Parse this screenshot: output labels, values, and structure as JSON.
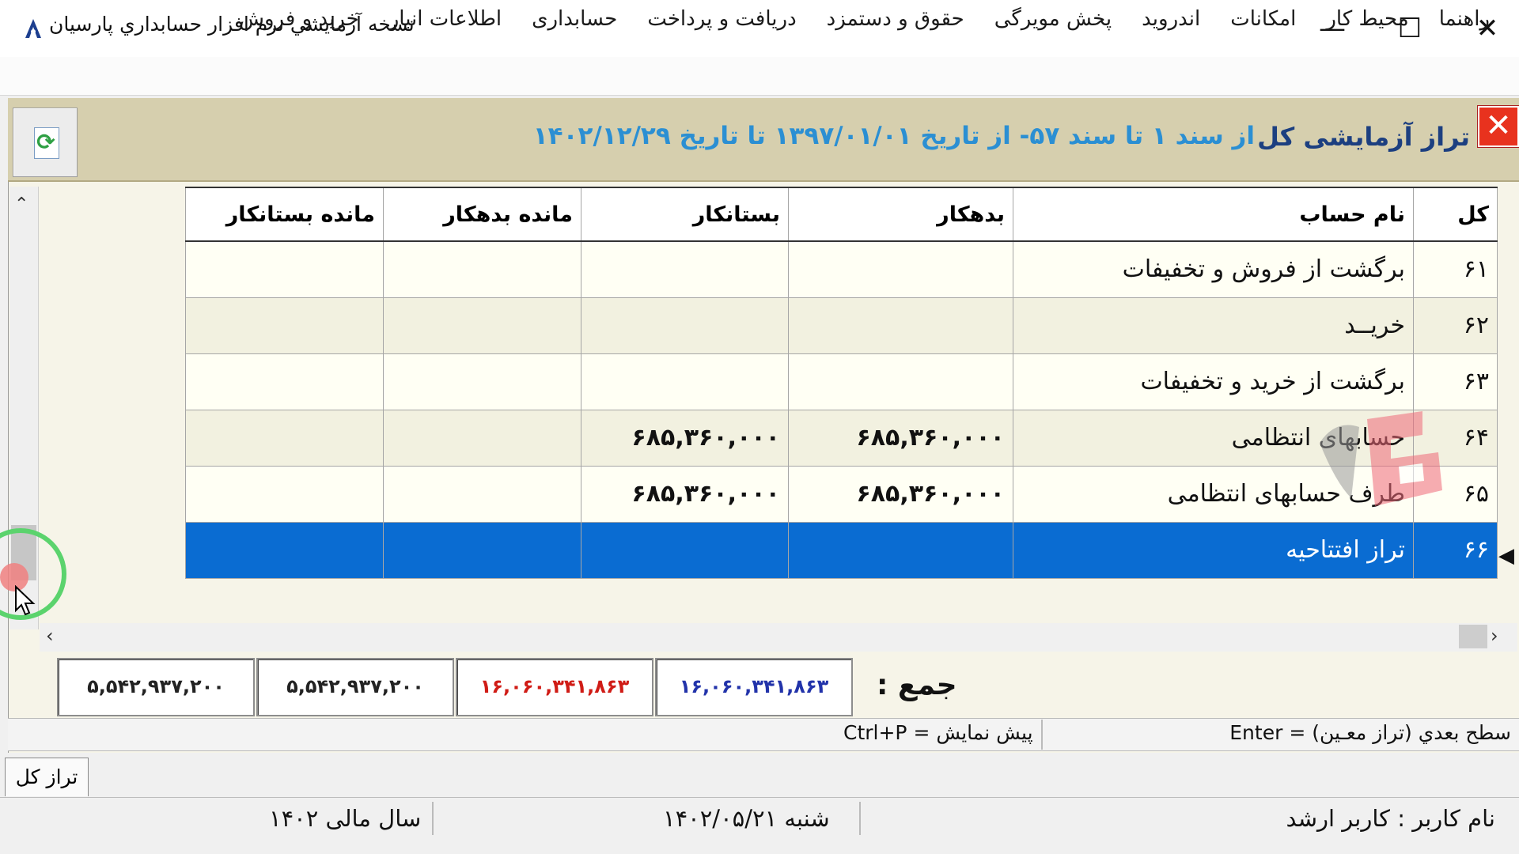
{
  "window": {
    "title": "نسخه آزمايشي نرم افزار حسابداري پارسيان",
    "min_glyph": "—",
    "max_glyph": "☐",
    "close_glyph": "✕",
    "icon": "app-logo-icon"
  },
  "menu": [
    "خرید و فروش",
    "اطلاعات انبار",
    "حسابداری",
    "دریافت و پرداخت",
    "حقوق و دستمزد",
    "پخش مویرگی",
    "اندروید",
    "امکانات",
    "محیط کار",
    "راهنما"
  ],
  "report": {
    "title": "تراز آزمایشی کل",
    "range": "از سند ۱ تا سند ۵۷- از تاریخ ۱۳۹۷/۰۱/۰۱ تا تاریخ ۱۴۰۲/۱۲/۲۹",
    "close_glyph": "✕",
    "refresh_icon": "refresh-icon"
  },
  "table": {
    "columns": [
      "کل",
      "نام حساب",
      "بدهکار",
      "بستانکار",
      "مانده بدهکار",
      "مانده بستانکار"
    ],
    "rows": [
      {
        "code": "۶۱",
        "name": "برگشت  از فروش  و تخفیفات",
        "debit": "",
        "credit": "",
        "bal_debit": "",
        "bal_credit": ""
      },
      {
        "code": "۶۲",
        "name": "خریــد",
        "debit": "",
        "credit": "",
        "bal_debit": "",
        "bal_credit": ""
      },
      {
        "code": "۶۳",
        "name": "برگشت  از خرید و تخفیفات",
        "debit": "",
        "credit": "",
        "bal_debit": "",
        "bal_credit": ""
      },
      {
        "code": "۶۴",
        "name": "حسابهای انتظامی",
        "debit": "۶۸۵,۳۶۰,۰۰۰",
        "credit": "۶۸۵,۳۶۰,۰۰۰",
        "bal_debit": "",
        "bal_credit": ""
      },
      {
        "code": "۶۵",
        "name": "طرف حسابهای انتظامی",
        "debit": "۶۸۵,۳۶۰,۰۰۰",
        "credit": "۶۸۵,۳۶۰,۰۰۰",
        "bal_debit": "",
        "bal_credit": ""
      },
      {
        "code": "۶۶",
        "name": "تراز افتتاحیه",
        "debit": "",
        "credit": "",
        "bal_debit": "",
        "bal_credit": ""
      }
    ],
    "selected_row": 5
  },
  "totals": {
    "label": "جمع :",
    "debit": "۱۶,۰۶۰,۳۴۱,۸۶۳",
    "credit": "۱۶,۰۶۰,۳۴۱,۸۶۳",
    "bal_debit": "۵,۵۴۲,۹۳۷,۲۰۰",
    "bal_credit": "۵,۵۴۲,۹۳۷,۲۰۰"
  },
  "hints": {
    "next_level": "سطح بعدي (تراز معـین) = Enter",
    "preview": "پیش نمایش  = Ctrl+P"
  },
  "tab_label": "تراز کل",
  "status": {
    "user": "نام کاربر : کاربر ارشد",
    "date": "شنبه  ۱۴۰۲/۰۵/۲۱",
    "fiscal_year": "سال مالی ۱۴۰۲"
  },
  "colors": {
    "header_bg": "#d6cfae",
    "title_blue": "#1c3f80",
    "range_blue": "#2b8fd3",
    "selection": "#0a6cd2",
    "debit": "#2233aa",
    "credit": "#d01c16"
  }
}
